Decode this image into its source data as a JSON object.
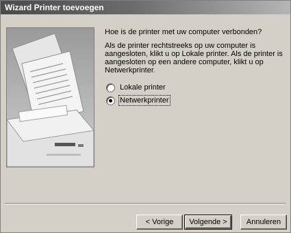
{
  "window": {
    "title": "Wizard Printer toevoegen"
  },
  "page": {
    "question": "Hoe is de printer met uw computer verbonden?",
    "info": "Als de printer rechtstreeks op uw computer is aangesloten, klikt u op Lokale printer. Als de printer is aangesloten op een andere computer, klikt u op Netwerkprinter.",
    "options": [
      {
        "label": "Lokale printer",
        "selected": false
      },
      {
        "label": "Netwerkprinter",
        "selected": true
      }
    ],
    "illustration_icon": "printer-illustration"
  },
  "buttons": {
    "back": "< Vorige",
    "next": "Volgende >",
    "cancel": "Annuleren"
  }
}
